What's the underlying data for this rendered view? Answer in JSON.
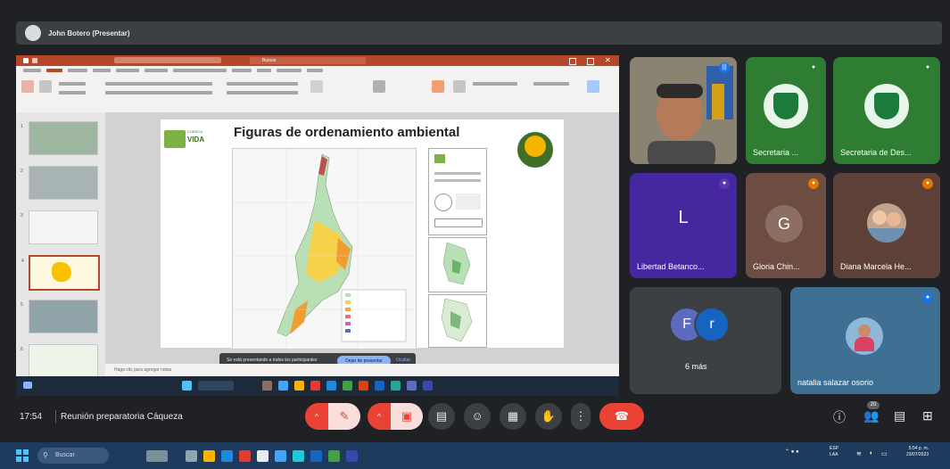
{
  "presenter": {
    "label": "John Botero (Presentar)"
  },
  "powerpoint": {
    "search_placeholder": "Buscar",
    "status_text": "Haga clic para agregar notas",
    "thumbnails": [
      "1",
      "2",
      "3",
      "4",
      "5",
      "6"
    ],
    "selected_thumbnail": 4
  },
  "slide": {
    "title": "Figuras de ordenamiento ambiental",
    "logo_line1": "CUENCA",
    "logo_line2": "VIDA"
  },
  "share_hint": {
    "text": "Se está presentando a todos los participantes",
    "primary_button": "Dejar de presentar",
    "secondary_button": "Ocultar"
  },
  "participants": [
    {
      "name": "",
      "type": "video",
      "mic": "active"
    },
    {
      "name": "Secretaria ...",
      "type": "logo",
      "mic": "on"
    },
    {
      "name": "Secretaria de Des...",
      "type": "logo",
      "mic": "on"
    },
    {
      "name": "Libertad Betanco...",
      "initial": "L",
      "type": "initial",
      "mic": "muted",
      "color": "#5e35b1"
    },
    {
      "name": "Gloria Chin...",
      "initial": "G",
      "type": "initial",
      "mic": "muted",
      "color": "#8d6e63"
    },
    {
      "name": "Diana Marcela He...",
      "type": "photo",
      "mic": "muted"
    },
    {
      "name": "6 más",
      "initials": [
        "F",
        "r"
      ],
      "type": "group"
    },
    {
      "name": "natalia salazar osorio",
      "type": "photo",
      "mic": "active"
    }
  ],
  "meeting": {
    "time": "17:54",
    "title": "Reunión preparatoria Cáqueza",
    "people_count": "20"
  },
  "taskbar": {
    "search_label": "Buscar",
    "lang_line1": "ESP",
    "lang_line2": "LAA",
    "clock_time": "5:54 p. m.",
    "clock_date": "23/07/2023"
  },
  "colors": {
    "end_call": "#ea4335",
    "muted_button": "#ea4335",
    "ppt_red": "#b7472a",
    "meet_bg": "#202124"
  }
}
